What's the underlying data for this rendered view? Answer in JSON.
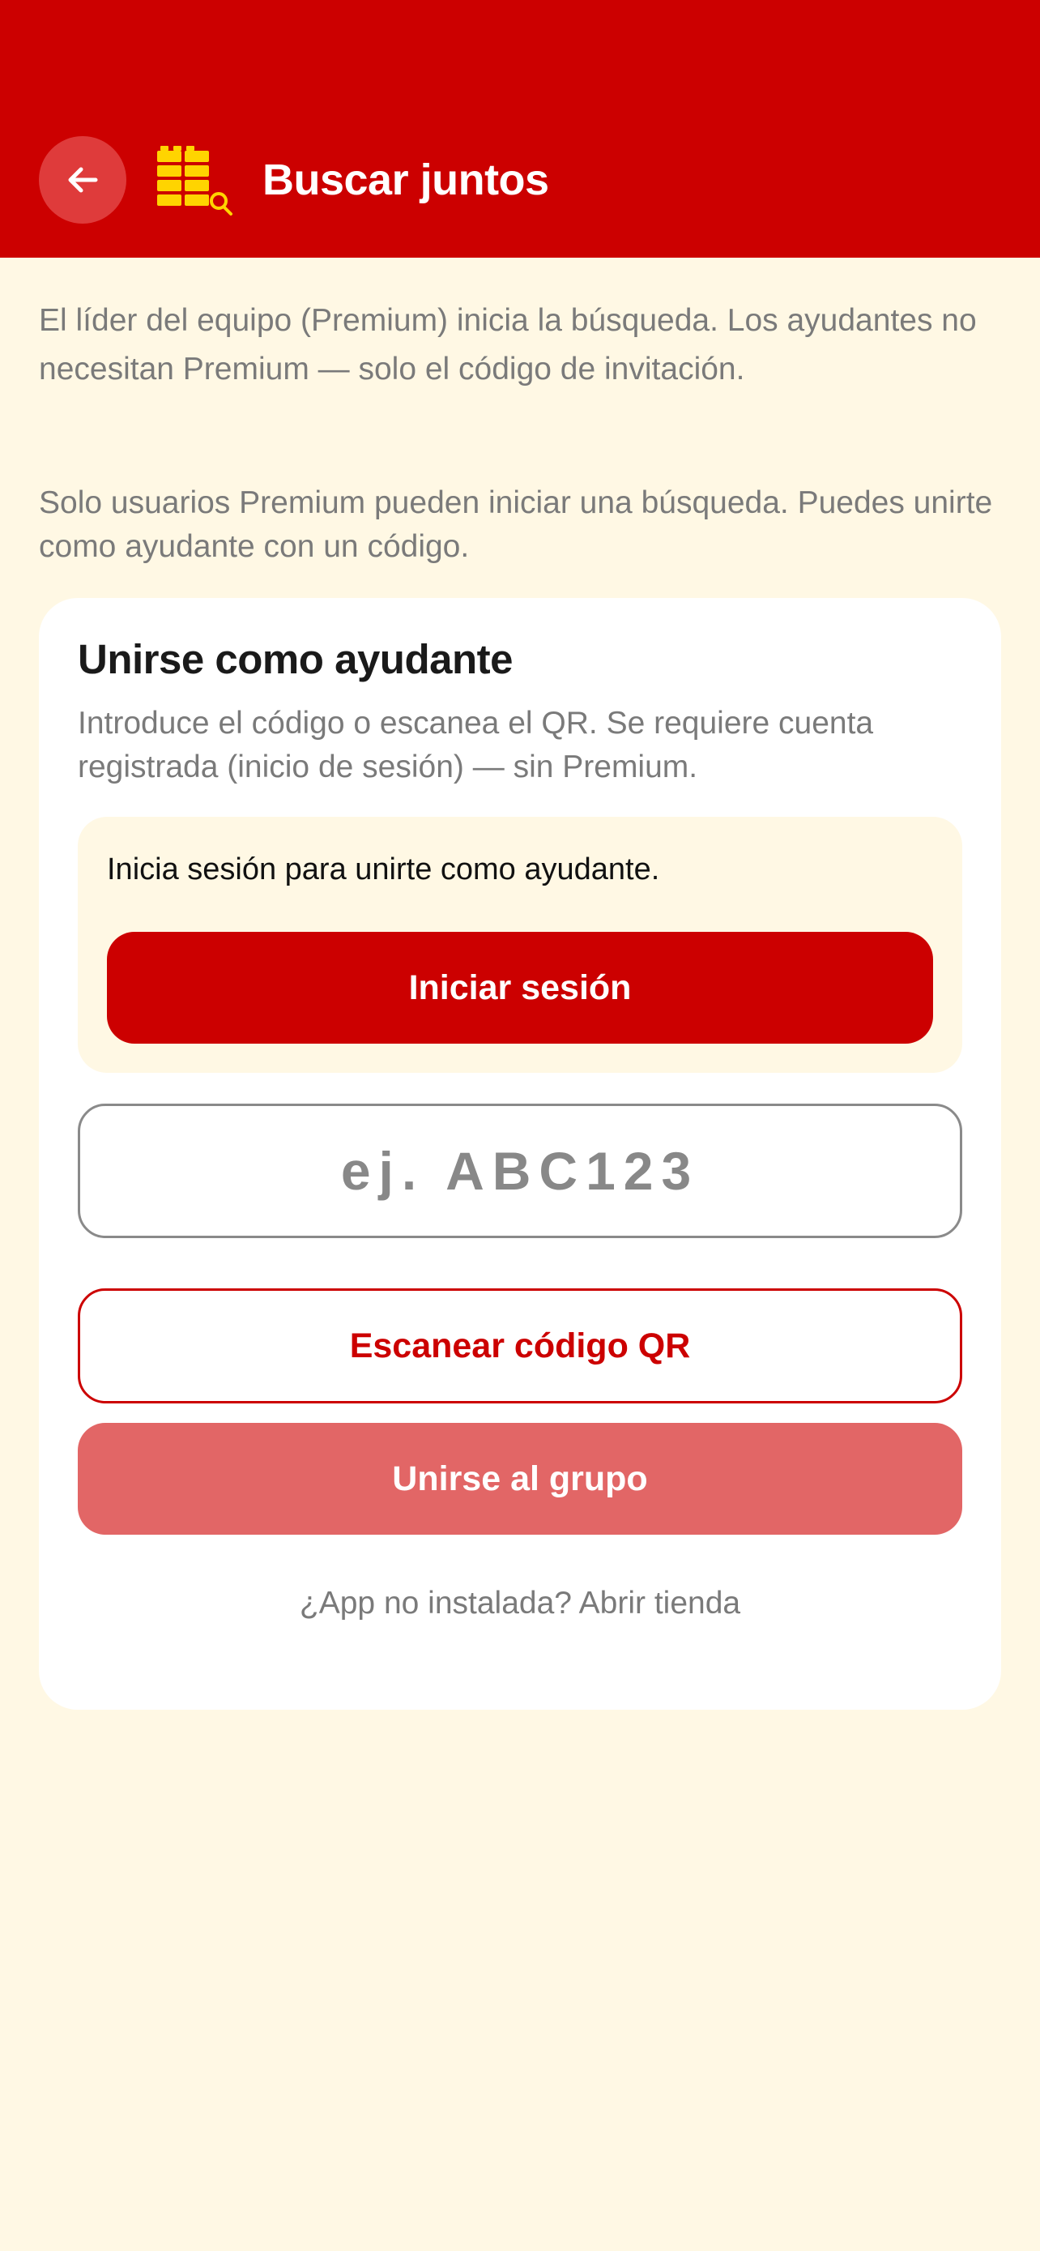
{
  "header": {
    "title": "Buscar juntos",
    "back_icon": "arrow-left-icon",
    "logo_icon": "bricks-search-icon",
    "background_color": "#CC0000"
  },
  "intro_text": "El líder del equipo (Premium) inicia la búsqueda. Los ayudantes no necesitan Premium — solo el código de invitación.",
  "premium_notice": "Solo usuarios Premium pueden iniciar una búsqueda. Puedes unirte como ayudante con un código.",
  "join_card": {
    "title": "Unirse como ayudante",
    "description": "Introduce el código o escanea el QR. Se requiere cuenta registrada (inicio de sesión) — sin Premium.",
    "login_prompt": {
      "message": "Inicia sesión para unirte como ayudante.",
      "button_label": "Iniciar sesión"
    },
    "code_input": {
      "placeholder": "ej. ABC123",
      "value": ""
    },
    "scan_button_label": "Escanear código QR",
    "join_button_label": "Unirse al grupo",
    "store_link": "¿App no instalada? Abrir tienda"
  },
  "colors": {
    "accent": "#CC0000",
    "accent_disabled": "#E26666",
    "background": "#FFF8E4",
    "logo": "#FFD400"
  }
}
